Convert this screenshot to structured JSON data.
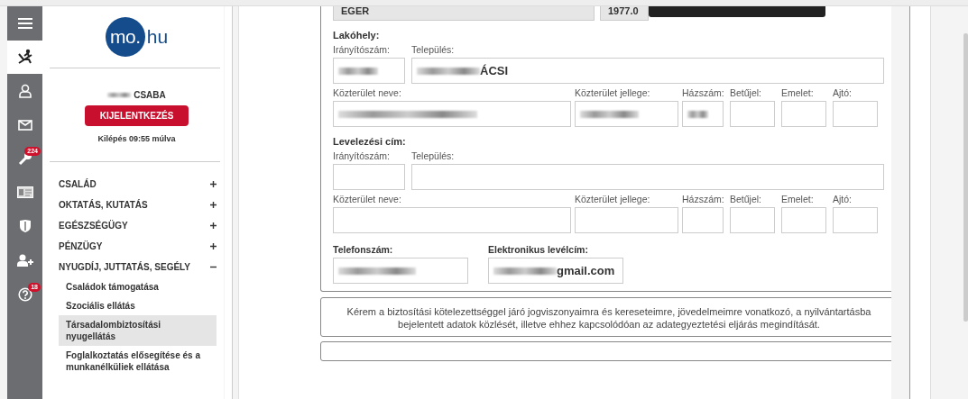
{
  "rail": [
    {
      "kind": "menu",
      "selected": false
    },
    {
      "kind": "chair",
      "selected": true
    },
    {
      "kind": "user",
      "selected": false
    },
    {
      "kind": "mail",
      "selected": false
    },
    {
      "kind": "wrench",
      "selected": false,
      "badge": "224"
    },
    {
      "kind": "card",
      "selected": false
    },
    {
      "kind": "shield",
      "selected": false
    },
    {
      "kind": "adduser",
      "selected": false
    },
    {
      "kind": "help",
      "selected": false,
      "badge": "18"
    }
  ],
  "logo": {
    "circle": "mo.",
    "suffix": "hu"
  },
  "user": {
    "name": "CSABA",
    "name_blurred_prefix": true,
    "logout": "KIJELENTKEZÉS",
    "timer": "Kilépés 09:55 múlva"
  },
  "menu": [
    {
      "label": "CSALÁD",
      "expanded": false
    },
    {
      "label": "OKTATÁS, KUTATÁS",
      "expanded": false
    },
    {
      "label": "EGÉSZSÉGÜGY",
      "expanded": false
    },
    {
      "label": "PÉNZÜGY",
      "expanded": false
    },
    {
      "label": "NYUGDÍJ, JUTTATÁS, SEGÉLY",
      "expanded": true,
      "children": [
        {
          "label": "Családok támogatása",
          "selected": false
        },
        {
          "label": "Szociális ellátás",
          "selected": false
        },
        {
          "label": "Társadalombiztosítási nyugellátás",
          "selected": true
        },
        {
          "label": "Foglalkoztatás elősegítése és a munkanélküliek ellátása",
          "selected": false
        }
      ]
    }
  ],
  "form": {
    "top_fields": [
      {
        "value": "EGER"
      },
      {
        "value": "1977.0"
      }
    ],
    "sections": [
      {
        "title": "Lakóhely:",
        "rows": [
          [
            {
              "label": "Irányítószám:",
              "blurred": true
            },
            {
              "label": "Település:",
              "value": "ÁCSI",
              "blurred": true
            }
          ],
          [
            {
              "label": "Közterület neve:",
              "blurred": true
            },
            {
              "label": "Közterület jellege:",
              "blurred": true
            },
            {
              "label": "Házszám:",
              "blurred": true
            },
            {
              "label": "Betűjel:",
              "blurred": false
            },
            {
              "label": "Emelet:",
              "blurred": false
            },
            {
              "label": "Ajtó:",
              "blurred": false
            }
          ]
        ]
      },
      {
        "title": "Levelezési cím:",
        "rows": [
          [
            {
              "label": "Irányítószám:",
              "blurred": false
            },
            {
              "label": "Település:",
              "blurred": false
            }
          ],
          [
            {
              "label": "Közterület neve:",
              "blurred": false
            },
            {
              "label": "Közterület jellege:",
              "blurred": false
            },
            {
              "label": "Házszám:",
              "blurred": false
            },
            {
              "label": "Betűjel:",
              "blurred": false
            },
            {
              "label": "Emelet:",
              "blurred": false
            },
            {
              "label": "Ajtó:",
              "blurred": false
            }
          ]
        ]
      }
    ],
    "contact": [
      {
        "label": "Telefonszám:",
        "blurred": true
      },
      {
        "label": "Elektronikus levélcím:",
        "value": "gmail.com",
        "blurred": true
      }
    ]
  },
  "notice": "Kérem a biztosítási kötelezettséggel járó jogviszonyaimra és kereseteimre, jövedelmeimre vonatkozó, a nyilvántartásba bejelentett adatok közlését, illetve ehhez kapcsolódóan az adategyeztetési eljárás megindítását."
}
